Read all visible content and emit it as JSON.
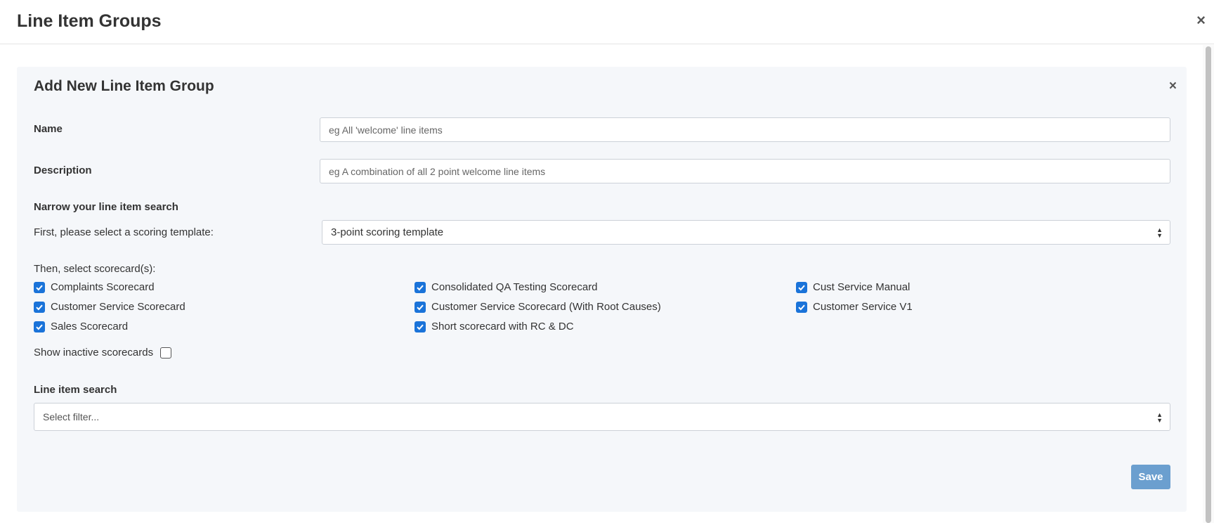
{
  "modal": {
    "title": "Line Item Groups",
    "close_glyph": "×"
  },
  "panel": {
    "title": "Add New Line Item Group",
    "close_glyph": "×",
    "name": {
      "label": "Name",
      "placeholder": "eg All 'welcome' line items",
      "value": ""
    },
    "description": {
      "label": "Description",
      "placeholder": "eg A combination of all 2 point welcome line items",
      "value": ""
    },
    "narrow": {
      "heading": "Narrow your line item search",
      "template_label": "First, please select a scoring template:",
      "template_value": "3-point scoring template",
      "scorecards_label": "Then, select scorecard(s):",
      "scorecards": [
        {
          "label": "Complaints Scorecard",
          "checked": true
        },
        {
          "label": "Consolidated QA Testing Scorecard",
          "checked": true
        },
        {
          "label": "Cust Service Manual",
          "checked": true
        },
        {
          "label": "Customer Service Scorecard",
          "checked": true
        },
        {
          "label": "Customer Service Scorecard (With Root Causes)",
          "checked": true
        },
        {
          "label": "Customer Service V1",
          "checked": true
        },
        {
          "label": "Sales Scorecard",
          "checked": true
        },
        {
          "label": "Short scorecard with RC & DC",
          "checked": true
        }
      ],
      "show_inactive": {
        "label": "Show inactive scorecards",
        "checked": false
      }
    },
    "search": {
      "label": "Line item search",
      "placeholder": "Select filter..."
    },
    "save_label": "Save"
  },
  "colors": {
    "checkbox": "#1a73d9",
    "save_button": "#6b9fcf",
    "panel_bg": "#f5f7fa"
  },
  "icons": {
    "checkmark": "check-icon",
    "select_caret": "chevron-updown-icon",
    "close": "close-icon"
  }
}
